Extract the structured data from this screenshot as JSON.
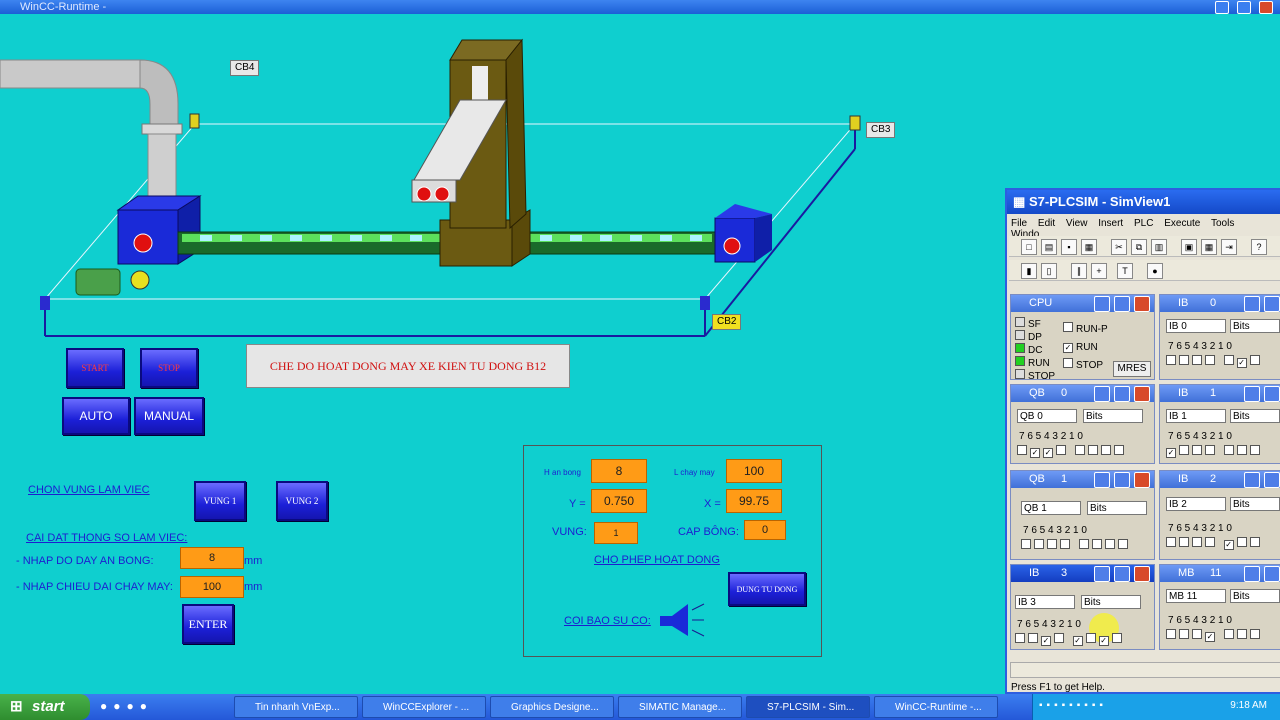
{
  "window": {
    "title": "WinCC-Runtime -"
  },
  "scene": {
    "tags": {
      "cb4": "CB4",
      "cb3": "CB3",
      "cb2": "CB2"
    },
    "mode_title": "CHE DO HOAT DONG MAY XE KIEN TU DONG B12",
    "buttons": {
      "start": "START",
      "stop": "STOP",
      "auto": "AUTO",
      "manual": "MANUAL",
      "vung1": "VUNG 1",
      "vung2": "VUNG 2",
      "enter": "ENTER",
      "dung_tu_dong": "DUNG TU DONG"
    },
    "chon_vung": "CHON VUNG LAM VIEC",
    "cai_dat": "CAI DAT THONG SO LAM VIEC:",
    "nhap_do_day": "- NHAP DO DAY AN BONG:",
    "nhap_chieu_dai": "- NHAP CHIEU DAI CHAY MAY:",
    "do_day_value": "8",
    "chieu_dai_value": "100",
    "unit_mm": "mm"
  },
  "status_panel": {
    "h_an_bong_label": "H an bong",
    "h_an_bong_value": "8",
    "l_chay_may_label": "L chay may",
    "l_chay_may_value": "100",
    "y_label": "Y =",
    "y_value": "0.750",
    "x_label": "X =",
    "x_value": "99.75",
    "vung_label": "VUNG:",
    "vung_value": "1",
    "cap_bong_label": "CAP BÔNG:",
    "cap_bong_value": "0",
    "cho_phep": "CHO PHEP HOAT DONG",
    "coi_bao": "COI BAO SU CO:"
  },
  "plcsim": {
    "title": "S7-PLCSIM - SimView1",
    "menu": [
      "File",
      "Edit",
      "View",
      "Insert",
      "PLC",
      "Execute",
      "Tools",
      "Windo"
    ],
    "cpu": {
      "title": "CPU",
      "leds": [
        "SF",
        "DP",
        "DC",
        "RUN",
        "STOP"
      ],
      "modes": [
        "RUN-P",
        "RUN",
        "STOP"
      ],
      "mres": "MRES"
    },
    "status": "Press F1 to get Help.",
    "bit_labels": "7 6 5 4   3 2 1 0",
    "bits": "Bits",
    "windows": [
      {
        "name": "IB",
        "num": "0",
        "field": "IB 0"
      },
      {
        "name": "QB",
        "num": "0",
        "field": "QB 0"
      },
      {
        "name": "IB",
        "num": "1",
        "field": "IB 1"
      },
      {
        "name": "QB",
        "num": "1",
        "field": "QB 1"
      },
      {
        "name": "IB",
        "num": "2",
        "field": "IB 2"
      },
      {
        "name": "IB",
        "num": "3",
        "field": "IB 3"
      },
      {
        "name": "MB",
        "num": "11",
        "field": "MB 11"
      }
    ]
  },
  "taskbar": {
    "start": "start",
    "tasks": [
      "Tin nhanh VnExp...",
      "WinCCExplorer - ...",
      "Graphics Designe...",
      "SIMATIC Manage...",
      "S7-PLCSIM - Sim...",
      "WinCC-Runtime -..."
    ],
    "clock": "9:18 AM"
  },
  "colors": {
    "background": "#0fcfcf",
    "orange": "#ff9b16",
    "button_blue": "#1c20d8",
    "xp_blue": "#2458d8"
  }
}
